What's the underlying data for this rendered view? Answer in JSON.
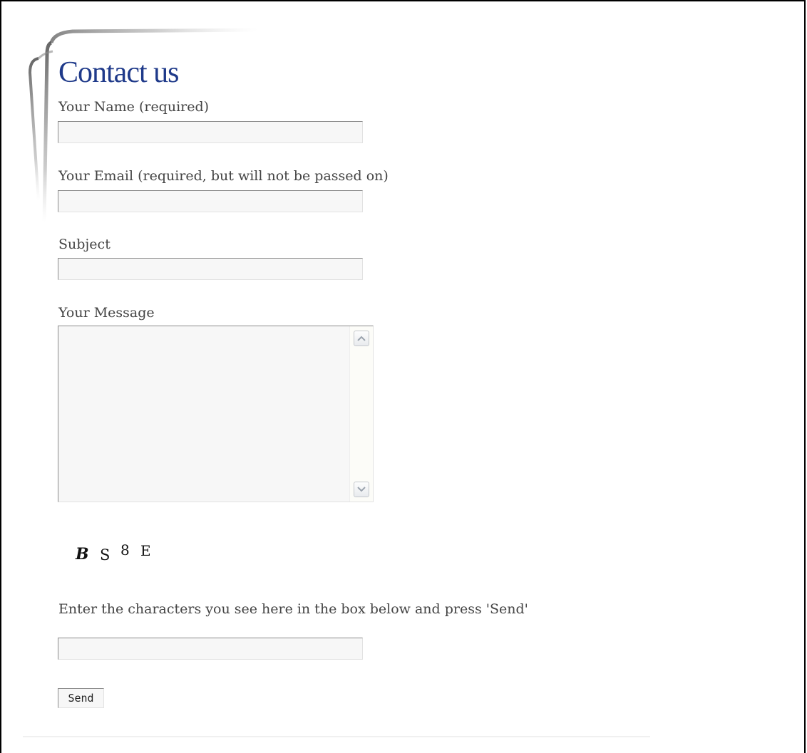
{
  "page": {
    "title": "Contact us"
  },
  "form": {
    "name_label": "Your Name (required)",
    "name_value": "",
    "email_label": "Your Email (required, but will not be passed on)",
    "email_value": "",
    "subject_label": "Subject",
    "subject_value": "",
    "message_label": "Your Message",
    "message_value": "",
    "captcha_chars": [
      "B",
      "S",
      "8",
      "E"
    ],
    "captcha_instruction": "Enter the characters you see here in the box below and press 'Send'",
    "captcha_value": "",
    "send_label": "Send"
  },
  "icons": {
    "scroll_up": "chevron-up-icon",
    "scroll_down": "chevron-down-icon"
  },
  "colors": {
    "title": "#1f3a8a",
    "label": "#444444",
    "field_bg": "#f7f7f7"
  }
}
